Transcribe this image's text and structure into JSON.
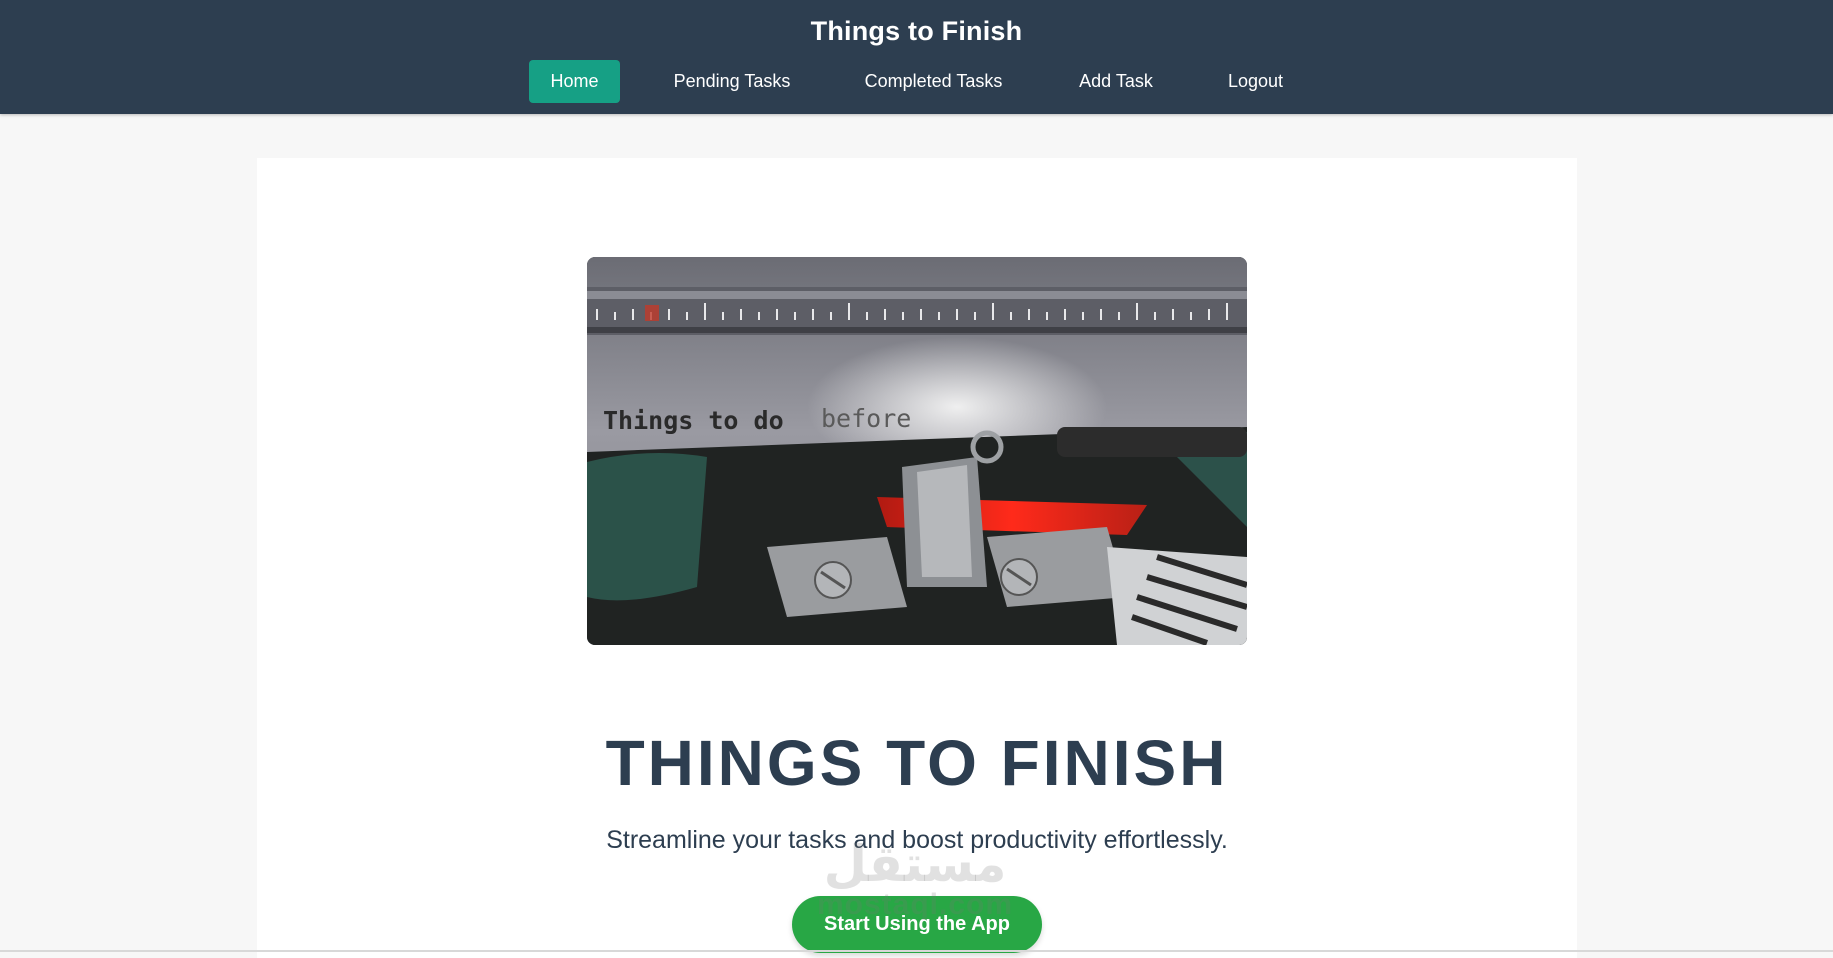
{
  "header": {
    "site_title": "Things to Finish",
    "nav": [
      {
        "label": "Home",
        "active": true
      },
      {
        "label": "Pending Tasks",
        "active": false
      },
      {
        "label": "Completed Tasks",
        "active": false
      },
      {
        "label": "Add Task",
        "active": false
      },
      {
        "label": "Logout",
        "active": false
      }
    ]
  },
  "hero": {
    "image_caption_typed": "Things to do before",
    "title": "THINGS TO FINISH",
    "subtitle": "Streamline your tasks and boost productivity effortlessly.",
    "cta_label": "Start Using the App"
  },
  "watermark": {
    "arabic": "مستقل",
    "latin": "mostaql.com"
  },
  "colors": {
    "header_bg": "#2d3e50",
    "nav_active_bg": "#16a085",
    "cta_bg": "#28a745",
    "title_text": "#2d3e50",
    "page_bg": "#f7f7f7"
  }
}
